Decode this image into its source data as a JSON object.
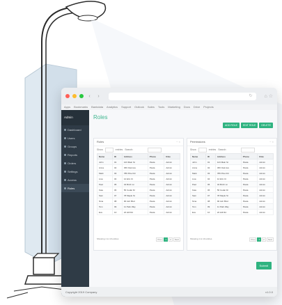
{
  "window": {
    "url": "",
    "nav_back": "‹",
    "nav_forward": "›",
    "reload": "↻",
    "toolbar_icons": "⌂ ☆",
    "traffic_colors": [
      "#ff5f57",
      "#febc2e",
      "#28c840"
    ],
    "bookmarks": [
      "Apps",
      "Bookmarks",
      "Bankdata",
      "Analytics",
      "Support",
      "Outlook",
      "Sales",
      "Tools",
      "Marketing",
      "Docs",
      "Drive",
      "Projects"
    ]
  },
  "sidebar": {
    "brand": "Admin",
    "items": [
      {
        "label": "Dashboard",
        "active": false
      },
      {
        "label": "Users",
        "active": false
      },
      {
        "label": "Groups",
        "active": false
      },
      {
        "label": "Reports",
        "active": false
      },
      {
        "label": "Orders",
        "active": false
      },
      {
        "label": "Settings",
        "active": false
      },
      {
        "label": "Access",
        "active": false
      },
      {
        "label": "Roles",
        "active": true
      }
    ]
  },
  "main": {
    "title": "Roles",
    "actions": [
      "ADD ROLE",
      "EDIT ROLE",
      "DELETE"
    ],
    "submit_label": "Submit"
  },
  "panels": [
    {
      "title": "Roles",
      "filter_show": "Show",
      "filter_entries": "entries",
      "filter_search": "Search:",
      "columns": [
        "Name",
        "ID",
        "Address",
        "Phone",
        "Role"
      ],
      "rows": [
        [
          "John",
          "01",
          "123 Main St",
          "Pasta",
          "Admin"
        ],
        [
          "Anna",
          "02",
          "456 Oak Ave",
          "Pasta",
          "Admin"
        ],
        [
          "Mark",
          "03",
          "789 Pine Rd",
          "Pasta",
          "Admin"
        ],
        [
          "Lisa",
          "04",
          "12 Elm Ct",
          "Pasta",
          "Admin"
        ],
        [
          "Paul",
          "05",
          "34 Birch Ln",
          "Pasta",
          "Admin"
        ],
        [
          "Kate",
          "06",
          "56 Cedar Dr",
          "Pasta",
          "Admin"
        ],
        [
          "Sam",
          "07",
          "78 Maple St",
          "Pasta",
          "Admin"
        ],
        [
          "Nina",
          "08",
          "90 Ash Blvd",
          "Pasta",
          "Admin"
        ],
        [
          "Tom",
          "09",
          "11 Park Way",
          "Pasta",
          "Admin"
        ],
        [
          "Eve",
          "10",
          "22 Hill Rd",
          "Pasta",
          "Admin"
        ]
      ],
      "footer_info": "Showing 1 to 10 entries",
      "pager": [
        "Prev",
        "1",
        "2",
        "Next"
      ]
    },
    {
      "title": "Permissions",
      "filter_show": "Show",
      "filter_entries": "entries",
      "filter_search": "Search:",
      "columns": [
        "Name",
        "ID",
        "Address",
        "Phone",
        "Role"
      ],
      "rows": [
        [
          "John",
          "01",
          "123 Main St",
          "Pasta",
          "Admin"
        ],
        [
          "Anna",
          "02",
          "456 Oak Ave",
          "Pasta",
          "Admin"
        ],
        [
          "Mark",
          "03",
          "789 Pine Rd",
          "Pasta",
          "Admin"
        ],
        [
          "Lisa",
          "04",
          "12 Elm Ct",
          "Pasta",
          "Admin"
        ],
        [
          "Paul",
          "05",
          "34 Birch Ln",
          "Pasta",
          "Admin"
        ],
        [
          "Kate",
          "06",
          "56 Cedar Dr",
          "Pasta",
          "Admin"
        ],
        [
          "Sam",
          "07",
          "78 Maple St",
          "Pasta",
          "Admin"
        ],
        [
          "Nina",
          "08",
          "90 Ash Blvd",
          "Pasta",
          "Admin"
        ],
        [
          "Tom",
          "09",
          "11 Park Way",
          "Pasta",
          "Admin"
        ],
        [
          "Eve",
          "10",
          "22 Hill Rd",
          "Pasta",
          "Admin"
        ]
      ],
      "footer_info": "Showing 1 to 10 entries",
      "pager": [
        "Prev",
        "1",
        "2",
        "Next"
      ]
    }
  ],
  "status": {
    "left": "Copyright 2019 Company",
    "right": "v1.0.0"
  },
  "accent_color": "#2fb380"
}
